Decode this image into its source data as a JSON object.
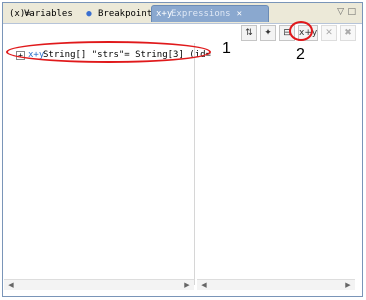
{
  "tabs": [
    {
      "icon": "(x)=",
      "label": "Variables",
      "active": false
    },
    {
      "icon": "●",
      "label": "Breakpoints",
      "active": false
    },
    {
      "icon": "x+y",
      "label": "Expressions",
      "active": true
    }
  ],
  "toolbar": {
    "buttons": [
      {
        "icon": "show-type-names-icon",
        "glyph": "⇅"
      },
      {
        "icon": "show-logical-structure-icon",
        "glyph": "✦"
      },
      {
        "icon": "collapse-all-icon",
        "glyph": "⊟"
      },
      {
        "icon": "add-watch-expression-icon",
        "glyph": "x+y"
      },
      {
        "icon": "remove-expression-icon",
        "glyph": "✕"
      },
      {
        "icon": "remove-all-expressions-icon",
        "glyph": "✖"
      }
    ]
  },
  "expression_row": {
    "expand": "+",
    "icon": "x+y",
    "text": "String[] \"strs\"= String[3]  (id="
  },
  "annotations": {
    "label1": "1",
    "label2": "2"
  }
}
